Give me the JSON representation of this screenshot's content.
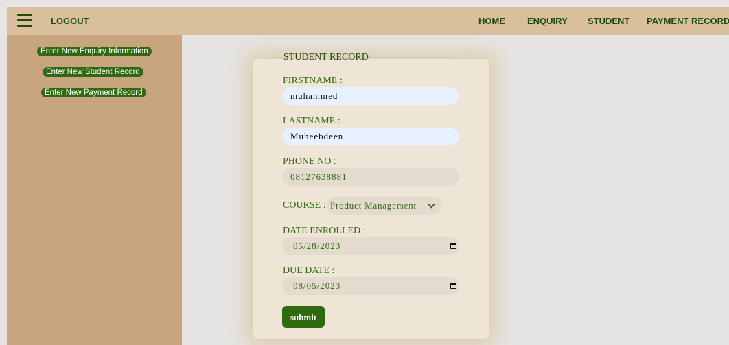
{
  "header": {
    "logout_label": "LOGOUT",
    "nav": {
      "home": "HOME",
      "enquiry": "ENQUIRY",
      "student": "STUDENT",
      "payment_record": "PAYMENT RECORD"
    },
    "menu_icon": "hamburger-menu-icon"
  },
  "sidebar": {
    "items": [
      {
        "label": "Enter New Enquiry Information"
      },
      {
        "label": "Enter New Student Record"
      },
      {
        "label": "Enter New Payment Record"
      }
    ]
  },
  "form": {
    "legend": "STUDENT RECORD",
    "firstname": {
      "label": "FIRSTNAME :",
      "value": "muhammed"
    },
    "lastname": {
      "label": "LASTNAME :",
      "value": "Muheebdeen"
    },
    "phone": {
      "label": "PHONE NO :",
      "value": "08127638881"
    },
    "course": {
      "label": "COURSE :",
      "selected": "Product Management"
    },
    "date_enrolled": {
      "label": "DATE ENROLLED :",
      "value": "05/28/2023"
    },
    "due_date": {
      "label": "DUE DATE :",
      "value": "08/05/2023"
    },
    "submit_label": "submit"
  },
  "colors": {
    "topbar": "#d9bf9c",
    "sidebar": "#c9a57f",
    "accent_green": "#2f6a10",
    "page_bg": "#e6e4e2",
    "card_bg": "#efe5d6"
  }
}
